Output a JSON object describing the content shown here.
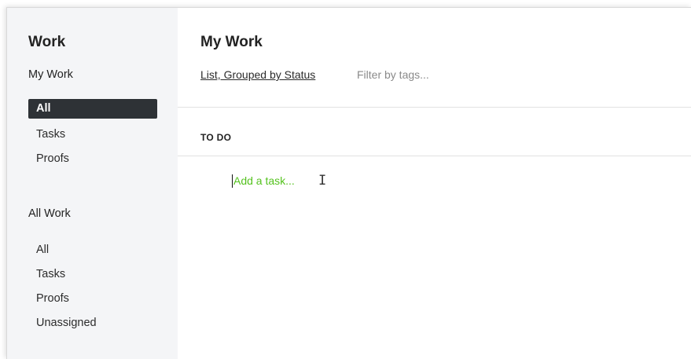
{
  "sidebar": {
    "title": "Work",
    "my_work": {
      "heading": "My Work",
      "items": [
        {
          "label": "All",
          "active": true
        },
        {
          "label": "Tasks",
          "active": false
        },
        {
          "label": "Proofs",
          "active": false
        }
      ]
    },
    "all_work": {
      "heading": "All Work",
      "items": [
        {
          "label": "All"
        },
        {
          "label": "Tasks"
        },
        {
          "label": "Proofs"
        },
        {
          "label": "Unassigned"
        }
      ]
    }
  },
  "main": {
    "title": "My Work",
    "view_label": "List, Grouped by Status",
    "filter_placeholder": "Filter by tags...",
    "filter_value": "",
    "groups": [
      {
        "header": "TO DO",
        "add_task_placeholder": "Add a task..."
      }
    ]
  },
  "colors": {
    "sidebar_bg": "#f4f5f7",
    "active_item_bg": "#2e3236",
    "add_task_text": "#55c21f"
  },
  "icons": {
    "cursor": "i-beam-cursor-icon"
  }
}
